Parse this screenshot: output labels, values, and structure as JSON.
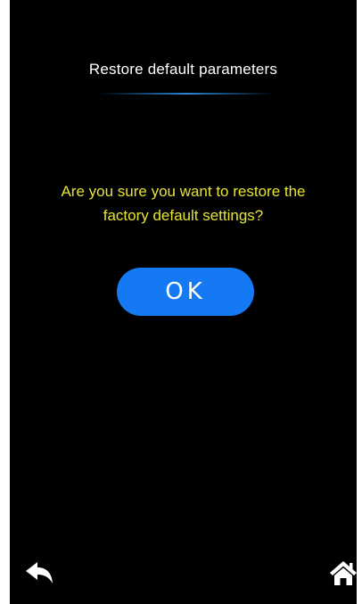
{
  "dialog": {
    "title": "Restore default parameters",
    "message_line1": "Are you sure you want to restore the",
    "message_line2": "factory default settings?",
    "ok_label": "OK"
  },
  "nav": {
    "back_icon": "back-arrow-icon",
    "home_icon": "home-icon"
  },
  "colors": {
    "background": "#000000",
    "title_text": "#ffffff",
    "message_text": "#e8e432",
    "ok_button": "#1479f2",
    "underline_accent": "#288ce6"
  }
}
